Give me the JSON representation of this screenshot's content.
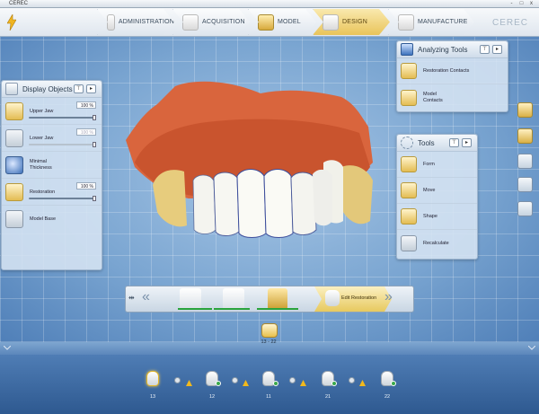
{
  "window": {
    "title": "CEREC",
    "controls": [
      "-",
      "□",
      "x"
    ]
  },
  "nav": {
    "steps": [
      {
        "label": "ADMINISTRATION",
        "icon": "administration-icon"
      },
      {
        "label": "ACQUISITION",
        "icon": "acquisition-icon"
      },
      {
        "label": "MODEL",
        "icon": "model-icon"
      },
      {
        "label": "DESIGN",
        "icon": "design-icon",
        "active": true
      },
      {
        "label": "MANUFACTURE",
        "icon": "manufacture-icon"
      }
    ],
    "brand": "CEREC"
  },
  "display_objects": {
    "title": "Display Objects",
    "items": [
      {
        "label": "Upper Jaw",
        "value": "100 %",
        "has_slider": true
      },
      {
        "label": "Lower Jaw",
        "value": "100 %",
        "has_slider": true,
        "disabled": true
      },
      {
        "label": "Minimal Thickness",
        "value": "",
        "has_slider": false
      },
      {
        "label": "Restoration",
        "value": "100 %",
        "has_slider": true
      },
      {
        "label": "Model Base",
        "value": "",
        "has_slider": false
      }
    ]
  },
  "analyzing_tools": {
    "title": "Analyzing Tools",
    "items": [
      {
        "label": "Restoration Contacts"
      },
      {
        "label": "Model Contacts"
      }
    ]
  },
  "tools": {
    "title": "Tools",
    "items": [
      {
        "label": "Form"
      },
      {
        "label": "Move"
      },
      {
        "label": "Shape"
      },
      {
        "label": "Recalculate"
      }
    ]
  },
  "step_bar": {
    "active_label": "Edit Restoration",
    "pin": "⇹",
    "prev": "«",
    "next": "»"
  },
  "current_selection": {
    "label": "13 - 22"
  },
  "teeth": [
    {
      "label": "13",
      "selected": true
    },
    {
      "label": "12"
    },
    {
      "label": "11"
    },
    {
      "label": "21"
    },
    {
      "label": "22"
    }
  ],
  "colors": {
    "accent": "#e9c45a",
    "workspace": "#7aa5d1",
    "bottom": "#2e5990",
    "ok": "#3aa84b",
    "warning": "#f2b91c"
  }
}
